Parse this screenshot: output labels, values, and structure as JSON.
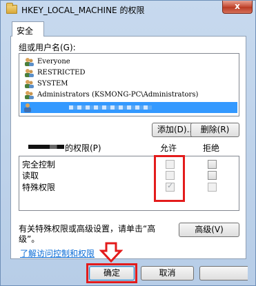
{
  "window": {
    "title": "HKEY_LOCAL_MACHINE 的权限",
    "close_label": "x"
  },
  "tabs": [
    {
      "label": "安全"
    }
  ],
  "groups_label": "组或用户名(G):",
  "users": [
    {
      "name": "Everyone",
      "icon": "users-group-icon"
    },
    {
      "name": "RESTRICTED",
      "icon": "users-group-icon"
    },
    {
      "name": "SYSTEM",
      "icon": "users-group-icon"
    },
    {
      "name": "Administrators (KSMONG-PC\\Administrators)",
      "icon": "users-group-icon"
    },
    {
      "name": "",
      "icon": "user-icon",
      "selected": true
    }
  ],
  "buttons": {
    "add": "添加(D)...",
    "remove": "删除(R)",
    "advanced": "高级(V)",
    "ok": "确定",
    "cancel": "取消"
  },
  "permissions": {
    "heading_suffix": "的权限(P)",
    "allow_header": "允许",
    "deny_header": "拒绝",
    "rows": [
      {
        "label": "完全控制",
        "allow": false,
        "deny": false
      },
      {
        "label": "读取",
        "allow": false,
        "deny": false
      },
      {
        "label": "特殊权限",
        "allow": true,
        "deny": false
      }
    ]
  },
  "advanced_note": "有关特殊权限或高级设置，请单击“高级”。",
  "advanced_note_line1": "有关特殊权限或高级设置，请单击“高",
  "advanced_note_line2": "级”。",
  "learn_link": "了解访问控制和权限",
  "colors": {
    "annotation_red": "#e31b1b",
    "selection_blue": "#3399ff",
    "link_blue": "#0a6cd6"
  }
}
